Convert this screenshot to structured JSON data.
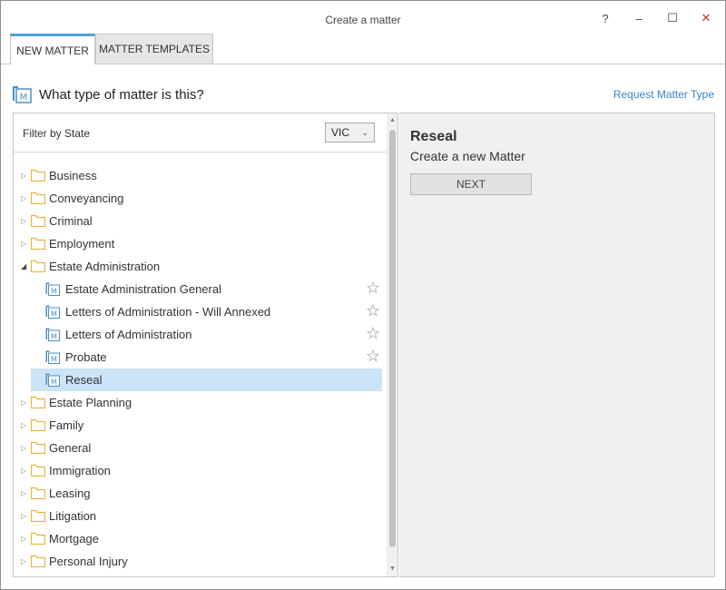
{
  "window": {
    "title": "Create a matter",
    "help_icon": "?",
    "minimize_icon": "–",
    "maximize_icon": "☐",
    "close_icon": "✕"
  },
  "tabs": [
    {
      "label": "NEW MATTER",
      "active": true
    },
    {
      "label": "MATTER TEMPLATES",
      "active": false
    }
  ],
  "question": "What type of matter is this?",
  "request_link": "Request Matter Type",
  "filter": {
    "label": "Filter by State",
    "selected": "VIC"
  },
  "tree": {
    "categories_before": [
      {
        "label": "Business",
        "expanded": false
      },
      {
        "label": "Conveyancing",
        "expanded": false
      },
      {
        "label": "Criminal",
        "expanded": false
      },
      {
        "label": "Employment",
        "expanded": false
      }
    ],
    "expanded_category": {
      "label": "Estate Administration",
      "expanded": true
    },
    "children": [
      {
        "label": "Estate Administration General",
        "selected": false
      },
      {
        "label": "Letters of Administration - Will Annexed",
        "selected": false
      },
      {
        "label": "Letters of Administration",
        "selected": false
      },
      {
        "label": "Probate",
        "selected": false
      },
      {
        "label": "Reseal",
        "selected": true
      }
    ],
    "categories_after": [
      {
        "label": "Estate Planning",
        "expanded": false
      },
      {
        "label": "Family",
        "expanded": false
      },
      {
        "label": "General",
        "expanded": false
      },
      {
        "label": "Immigration",
        "expanded": false
      },
      {
        "label": "Leasing",
        "expanded": false
      },
      {
        "label": "Litigation",
        "expanded": false
      },
      {
        "label": "Mortgage",
        "expanded": false
      },
      {
        "label": "Personal Injury",
        "expanded": false
      }
    ]
  },
  "detail": {
    "title": "Reseal",
    "subtitle": "Create a new Matter",
    "next_label": "NEXT"
  },
  "colors": {
    "accent": "#4ca3dc",
    "link": "#3a84c4",
    "selection": "#cce4f7",
    "folder": "#e8b33a",
    "matter_icon": "#4a90c8"
  }
}
